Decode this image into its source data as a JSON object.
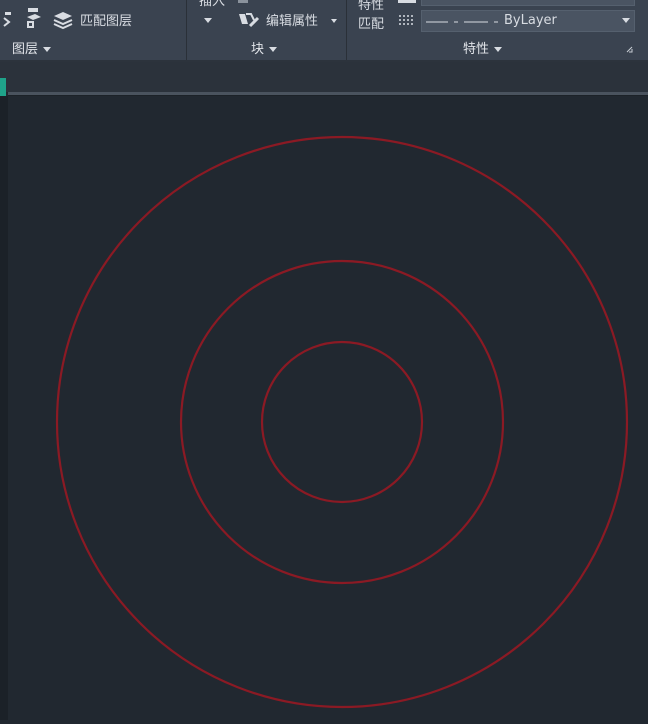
{
  "ribbon": {
    "layers_panel": {
      "match_layer_label": "匹配图层",
      "panel_label": "图层"
    },
    "block_panel": {
      "insert_label": "插入",
      "edit_attributes_label": "编辑属性",
      "panel_label": "块"
    },
    "properties_panel": {
      "match_properties_label_1": "特性",
      "match_properties_label_2": "匹配",
      "linetype_value": "ByLayer",
      "panel_label": "特性"
    }
  },
  "colors": {
    "ribbon_bg": "#3a4350",
    "canvas_bg": "#212830",
    "accent": "#1fa38a",
    "circle_stroke": "#8b1a24"
  },
  "drawing": {
    "shapes": [
      {
        "type": "circle",
        "name": "outer"
      },
      {
        "type": "circle",
        "name": "middle"
      },
      {
        "type": "circle",
        "name": "inner"
      }
    ]
  }
}
